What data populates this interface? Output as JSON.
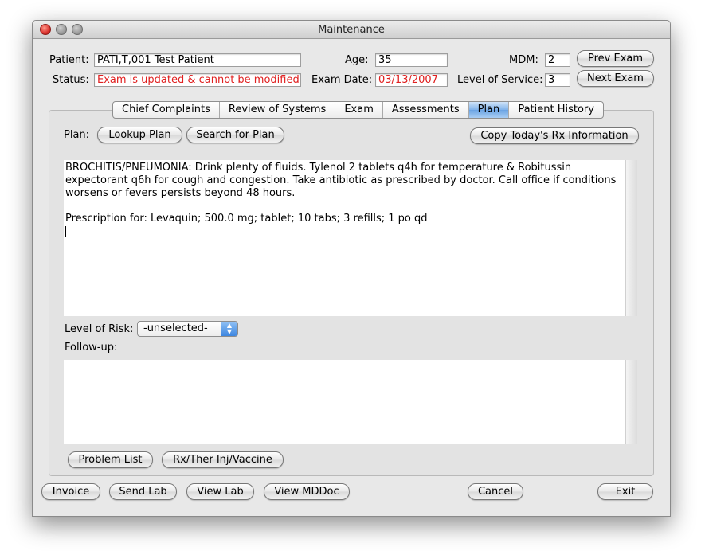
{
  "window": {
    "title": "Maintenance"
  },
  "header": {
    "patient_label": "Patient:",
    "patient_value": "PATI,T,001 Test Patient",
    "status_label": "Status:",
    "status_value": "Exam is updated & cannot be modified.",
    "age_label": "Age:",
    "age_value": "35",
    "exam_date_label": "Exam Date:",
    "exam_date_value": "03/13/2007",
    "mdm_label": "MDM:",
    "mdm_value": "2",
    "los_label": "Level of Service:",
    "los_value": "3",
    "prev_exam": "Prev Exam",
    "next_exam": "Next Exam"
  },
  "tabs": [
    {
      "label": "Chief Complaints",
      "active": false
    },
    {
      "label": "Review of Systems",
      "active": false
    },
    {
      "label": "Exam",
      "active": false
    },
    {
      "label": "Assessments",
      "active": false
    },
    {
      "label": "Plan",
      "active": true
    },
    {
      "label": "Patient History",
      "active": false
    }
  ],
  "plan": {
    "label": "Plan:",
    "lookup_button": "Lookup Plan",
    "search_button": "Search for Plan",
    "copy_button": "Copy Today's Rx Information",
    "text_p1": "BROCHITIS/PNEUMONIA: Drink plenty of fluids. Tylenol 2 tablets q4h for temperature & Robitussin expectorant q6h for cough and congestion. Take antibiotic as prescribed by doctor. Call office if conditions worsens or fevers persists beyond 48 hours.",
    "text_p2": "Prescription for: Levaquin; 500.0 mg; tablet; 10 tabs; 3 refills; 1 po qd",
    "risk_label": "Level of Risk:",
    "risk_value": "-unselected-",
    "followup_label": "Follow-up:",
    "followup_text": "",
    "problem_list_button": "Problem List",
    "rx_button": "Rx/Ther Inj/Vaccine"
  },
  "footer": {
    "invoice": "Invoice",
    "send_lab": "Send Lab",
    "view_lab": "View Lab",
    "view_mddoc": "View MDDoc",
    "cancel": "Cancel",
    "exit": "Exit"
  },
  "colors": {
    "status_red": "#e02020",
    "tab_active": "#7fb2ea"
  }
}
